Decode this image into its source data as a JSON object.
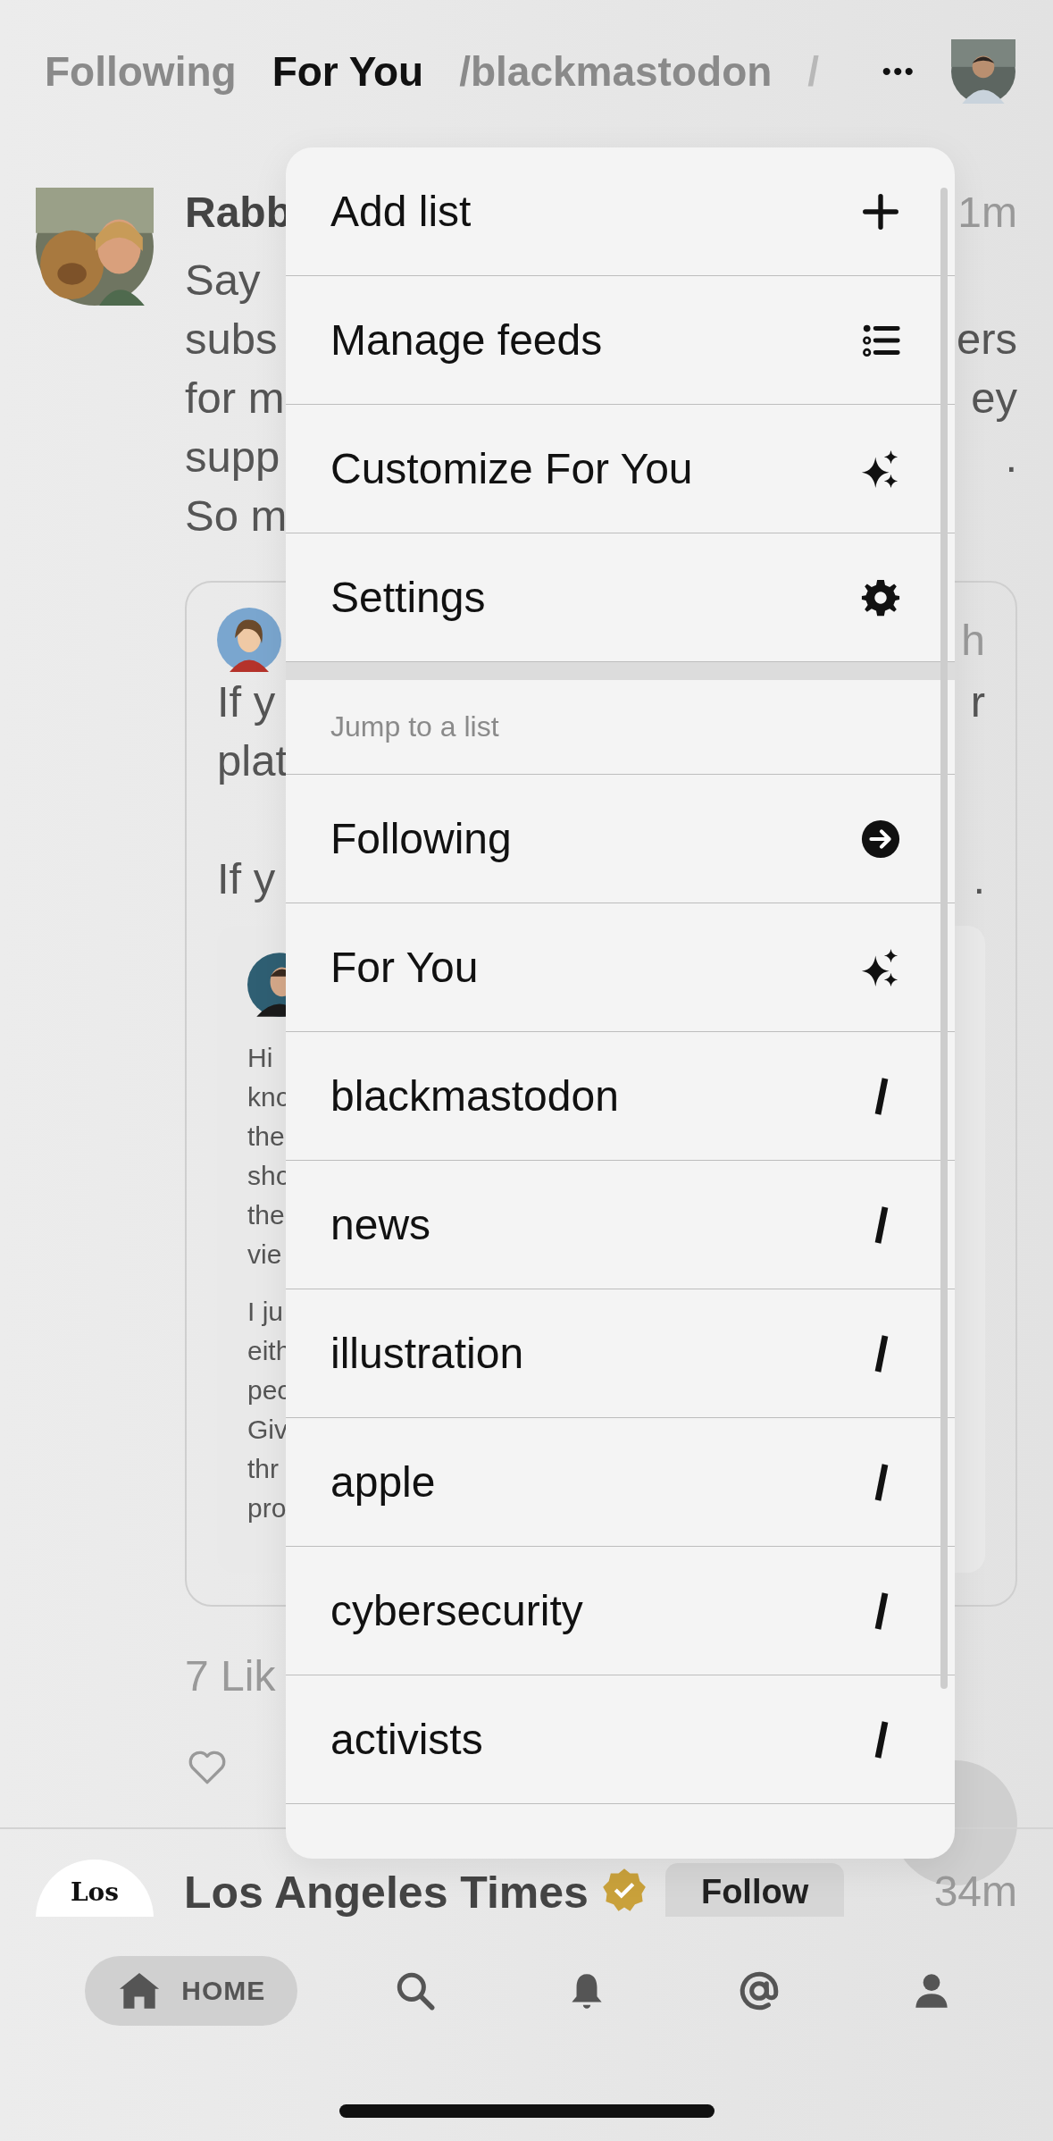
{
  "top_tabs": [
    {
      "label": "Following",
      "selected": false
    },
    {
      "label": "For You",
      "selected": true
    },
    {
      "label": "/blackmastodon",
      "selected": false
    },
    {
      "label": "/",
      "selected": false
    }
  ],
  "more_label": "•••",
  "post": {
    "author": "Rabb",
    "time": "1m",
    "lines": [
      {
        "left": "Say"
      },
      {
        "left": "subs",
        "right": "ers"
      },
      {
        "left": "for m",
        "right": "ey"
      },
      {
        "left": "supp",
        "right": "."
      },
      {
        "left": "So m"
      }
    ],
    "quote": {
      "time": "h",
      "lines": [
        {
          "left": "If y",
          "right": "r"
        },
        {
          "left": "plat"
        },
        {
          "left": "If y",
          "right": "."
        }
      ],
      "inner": {
        "paragraphs": [
          [
            "Hi",
            "kno",
            "the",
            "sho",
            "the",
            "vie"
          ],
          [
            "I ju",
            "eith",
            "peo",
            "Giv",
            "thr",
            "pro"
          ]
        ]
      }
    },
    "likes": "7 Lik"
  },
  "next_post": {
    "avatar_text": "Los",
    "author": "Los Angeles Times",
    "follow_label": "Follow",
    "time": "34m"
  },
  "menu": {
    "actions": [
      {
        "label": "Add list",
        "kind": "plus"
      },
      {
        "label": "Manage feeds",
        "kind": "list"
      },
      {
        "label": "Customize For You",
        "kind": "sparkle"
      },
      {
        "label": "Settings",
        "kind": "gear"
      }
    ],
    "section_title": "Jump to a list",
    "lists": [
      {
        "label": "Following",
        "kind": "arrow"
      },
      {
        "label": "For You",
        "kind": "sparkle"
      },
      {
        "label": "blackmastodon",
        "kind": "slash"
      },
      {
        "label": "news",
        "kind": "slash"
      },
      {
        "label": "illustration",
        "kind": "slash"
      },
      {
        "label": "apple",
        "kind": "slash"
      },
      {
        "label": "cybersecurity",
        "kind": "slash"
      },
      {
        "label": "activists",
        "kind": "slash"
      }
    ]
  },
  "nav": [
    {
      "label": "HOME",
      "kind": "home",
      "selected": true
    },
    {
      "kind": "search",
      "selected": false
    },
    {
      "kind": "bell",
      "selected": false
    },
    {
      "kind": "at",
      "selected": false
    },
    {
      "kind": "person",
      "selected": false
    }
  ]
}
